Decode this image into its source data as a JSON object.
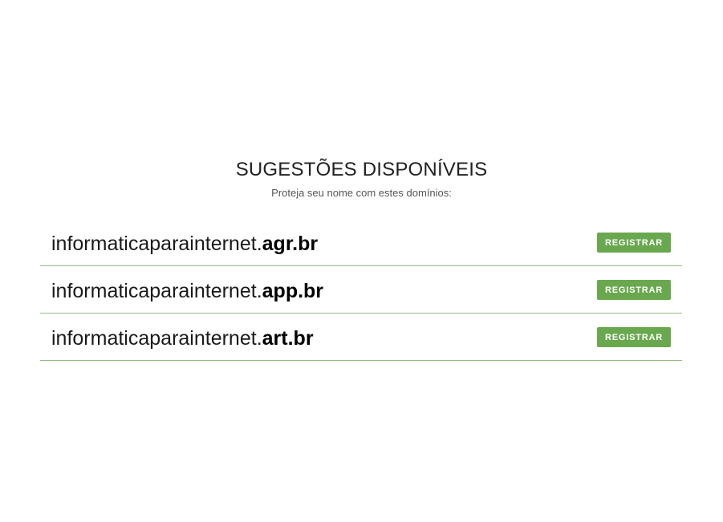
{
  "header": {
    "title": "SUGESTÕES DISPONÍVEIS",
    "subtitle": "Proteja seu nome com estes domínios:"
  },
  "suggestions": [
    {
      "name": "informaticaparainternet.",
      "ext": "agr.br",
      "button_label": "REGISTRAR"
    },
    {
      "name": "informaticaparainternet.",
      "ext": "app.br",
      "button_label": "REGISTRAR"
    },
    {
      "name": "informaticaparainternet.",
      "ext": "art.br",
      "button_label": "REGISTRAR"
    }
  ],
  "colors": {
    "accent": "#6aa84f",
    "divider": "#8fbf7f"
  }
}
